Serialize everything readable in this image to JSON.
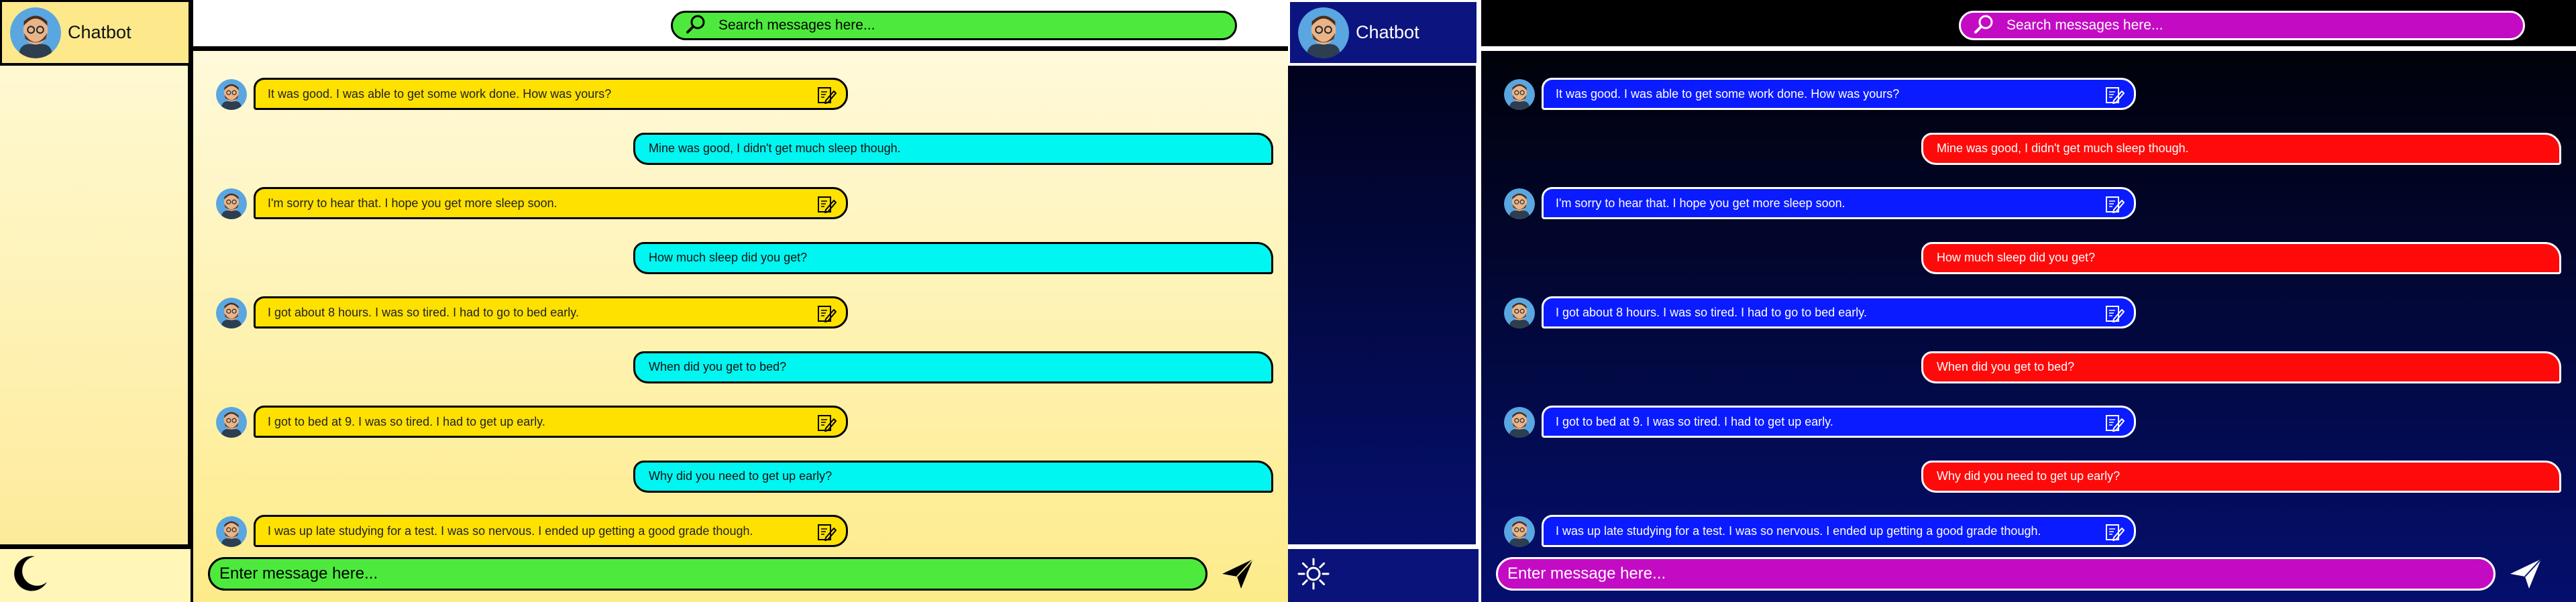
{
  "app": {
    "title": "Chatbot",
    "search_placeholder": "Search messages here...",
    "input_placeholder": "Enter message here..."
  },
  "themes": [
    {
      "mode": "light",
      "toggle_icon": "moon-icon",
      "colors": {
        "bot_bubble": "#ffe100",
        "user_bubble": "#00f6f0",
        "search": "#4dea3d",
        "input": "#4dea3d",
        "accent": "#000000"
      }
    },
    {
      "mode": "dark",
      "toggle_icon": "sun-icon",
      "colors": {
        "bot_bubble": "#0a1bff",
        "user_bubble": "#ff0a0a",
        "search": "#c40bc4",
        "input": "#c40bc4",
        "accent": "#ffffff"
      }
    }
  ],
  "messages": [
    {
      "from": "bot",
      "text": "It was good. I was able to get some work done. How was yours?",
      "action_icon": "edit-document-icon"
    },
    {
      "from": "user",
      "text": "Mine was good, I didn't get much sleep though."
    },
    {
      "from": "bot",
      "text": "I'm sorry to hear that. I hope you get more sleep soon.",
      "action_icon": "edit-document-icon"
    },
    {
      "from": "user",
      "text": "How much sleep did you get?"
    },
    {
      "from": "bot",
      "text": "I got about 8 hours. I was so tired. I had to go to bed early.",
      "action_icon": "edit-document-icon"
    },
    {
      "from": "user",
      "text": "When did you get to bed?"
    },
    {
      "from": "bot",
      "text": "I got to bed at 9. I was so tired. I had to get up early.",
      "action_icon": "edit-document-icon"
    },
    {
      "from": "user",
      "text": "Why did you need to get up early?"
    },
    {
      "from": "bot",
      "text": "I was up late studying for a test. I was so nervous. I ended up getting a good grade though.",
      "action_icon": "edit-document-icon"
    }
  ],
  "icons": {
    "search": "search-icon",
    "send": "send-icon",
    "avatar": "avatar"
  }
}
